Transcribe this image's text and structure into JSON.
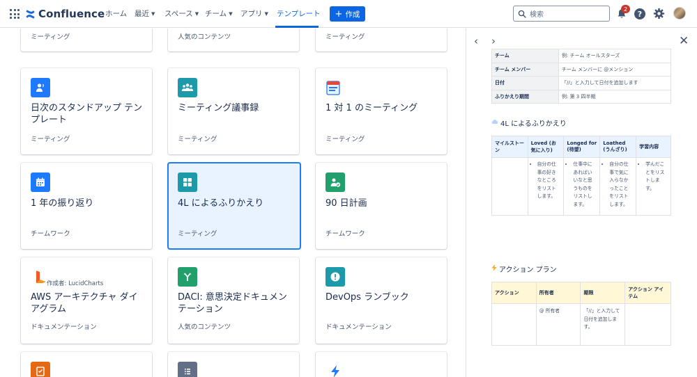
{
  "topnav": {
    "brand": "Confluence",
    "items": [
      {
        "label": "ホーム",
        "has_chevron": false
      },
      {
        "label": "最近",
        "has_chevron": true
      },
      {
        "label": "スペース",
        "has_chevron": true
      },
      {
        "label": "チーム",
        "has_chevron": true
      },
      {
        "label": "アプリ",
        "has_chevron": true
      },
      {
        "label": "テンプレート",
        "has_chevron": false,
        "active": true
      }
    ],
    "create_label": "作成",
    "search_placeholder": "検索",
    "notification_count": "2",
    "help_label": "?"
  },
  "templates": {
    "row0": [
      {
        "title": "",
        "category": "ミーティング"
      },
      {
        "title": "",
        "category": "人気のコンテンツ"
      },
      {
        "title": "",
        "category": "ミーティング"
      }
    ],
    "row1": [
      {
        "title": "日次のスタンドアップ テンプレート",
        "category": "ミーティング",
        "icon": "person-speaking-icon",
        "color": "#1d7afc"
      },
      {
        "title": "ミーティング議事録",
        "category": "ミーティング",
        "icon": "people-group-icon",
        "color": "#22a06b"
      },
      {
        "title": "1 対 1 のミーティング",
        "category": "ミーティング",
        "icon": "calendar-page-icon",
        "color": "#e2483d"
      }
    ],
    "row2": [
      {
        "title": "1 年の振り返り",
        "category": "チームワーク",
        "icon": "calendar-icon",
        "color": "#1d7afc"
      },
      {
        "title": "4L によるふりかえり",
        "category": "ミーティング",
        "icon": "four-squares-icon",
        "color": "#1d9aaa",
        "selected": true
      },
      {
        "title": "90 日計画",
        "category": "チームワーク",
        "icon": "person-check-icon",
        "color": "#22a06b"
      }
    ],
    "row3": [
      {
        "title": "AWS アーキテクチャ ダイアグラム",
        "category": "ドキュメンテーション",
        "author": "作成者: LucidCharts",
        "icon": "lucidchart-logo-icon",
        "color": "#f15a24"
      },
      {
        "title": "DACI: 意思決定ドキュメンテーション",
        "category": "人気のコンテンツ",
        "icon": "branch-arrow-icon",
        "color": "#22a06b"
      },
      {
        "title": "DevOps ランブック",
        "category": "ドキュメンテーション",
        "icon": "alert-circle-icon",
        "color": "#1d9aaa"
      }
    ],
    "row4": [
      {
        "icon": "checklist-book-icon",
        "color": "#e56910"
      },
      {
        "icon": "list-document-icon",
        "color": "#626f86"
      },
      {
        "icon": "lightning-icon",
        "color": "#1d7afc"
      }
    ]
  },
  "panel": {
    "prev_label": "‹",
    "next_label": "›",
    "close_label": "✕",
    "info_rows": [
      {
        "key": "チーム",
        "value": "例: チーム オールスターズ"
      },
      {
        "key": "チーム メンバー",
        "value": "チーム メンバーに @メンション"
      },
      {
        "key": "日付",
        "value": "「//」と入力して日付を追加します"
      },
      {
        "key": "ふりかえり期間",
        "value": "例: 第 3 四半期"
      }
    ],
    "retro_heading": "4L によるふりかえり",
    "retro_headers": [
      "マイルストーン",
      "Loved (お気に入り)",
      "Longed for (待望)",
      "Loathed (うんざり)",
      "学習内容"
    ],
    "retro_cells": [
      "",
      "自分の仕事の好きなところをリストします。",
      "仕事中にあればいいなと思うものをリストします。",
      "自分の仕事で気に入らなかったことをリストします。",
      "学んだことをリストします。"
    ],
    "action_heading": "アクション プラン",
    "action_headers": [
      "アクション",
      "所有者",
      "期限",
      "アクション アイテム"
    ],
    "action_cells": [
      "",
      "@ 所有者",
      "「//」と入力して日付を追加します。",
      ""
    ]
  }
}
